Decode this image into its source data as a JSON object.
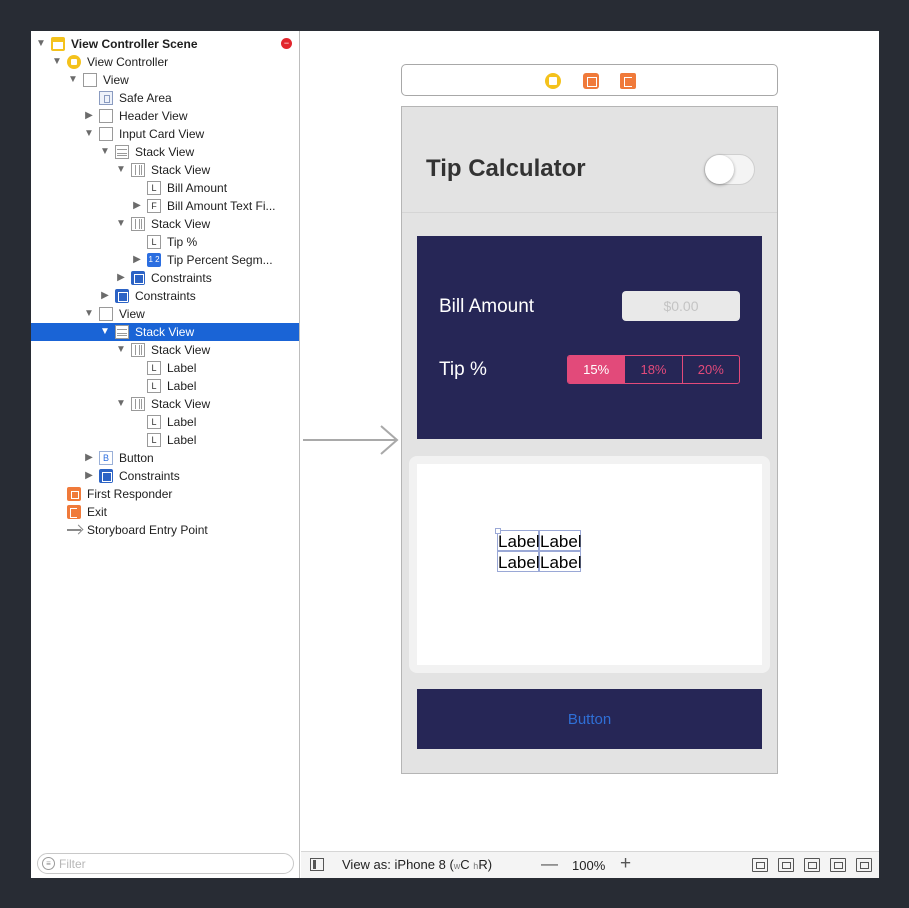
{
  "outline": {
    "rows": [
      {
        "label": "View Controller Scene",
        "depth": 0,
        "disclosure": "▼",
        "icon": "scene-icon",
        "bold": true
      },
      {
        "label": "View Controller",
        "depth": 1,
        "disclosure": "▼",
        "icon": "view-controller-icon"
      },
      {
        "label": "View",
        "depth": 2,
        "disclosure": "▼",
        "icon": "view-icon"
      },
      {
        "label": "Safe Area",
        "depth": 3,
        "disclosure": "",
        "icon": "safe-area-icon"
      },
      {
        "label": "Header View",
        "depth": 3,
        "disclosure": "▶",
        "icon": "view-icon"
      },
      {
        "label": "Input Card View",
        "depth": 3,
        "disclosure": "▼",
        "icon": "view-icon"
      },
      {
        "label": "Stack View",
        "depth": 4,
        "disclosure": "▼",
        "icon": "vertical-stack-icon"
      },
      {
        "label": "Stack View",
        "depth": 5,
        "disclosure": "▼",
        "icon": "horizontal-stack-icon"
      },
      {
        "label": "Bill Amount",
        "depth": 6,
        "disclosure": "",
        "icon": "label-icon",
        "glyph": "L"
      },
      {
        "label": "Bill Amount Text Fi...",
        "depth": 6,
        "disclosure": "▶",
        "icon": "textfield-icon",
        "glyph": "F"
      },
      {
        "label": "Stack View",
        "depth": 5,
        "disclosure": "▼",
        "icon": "horizontal-stack-icon"
      },
      {
        "label": "Tip %",
        "depth": 6,
        "disclosure": "",
        "icon": "label-icon",
        "glyph": "L"
      },
      {
        "label": "Tip Percent Segm...",
        "depth": 6,
        "disclosure": "▶",
        "icon": "segmented-control-icon",
        "glyph": "1 2"
      },
      {
        "label": "Constraints",
        "depth": 5,
        "disclosure": "▶",
        "icon": "constraints-icon"
      },
      {
        "label": "Constraints",
        "depth": 4,
        "disclosure": "▶",
        "icon": "constraints-icon"
      },
      {
        "label": "View",
        "depth": 3,
        "disclosure": "▼",
        "icon": "view-icon"
      },
      {
        "label": "Stack View",
        "depth": 4,
        "disclosure": "▼",
        "icon": "vertical-stack-icon",
        "selected": true
      },
      {
        "label": "Stack View",
        "depth": 5,
        "disclosure": "▼",
        "icon": "horizontal-stack-icon"
      },
      {
        "label": "Label",
        "depth": 6,
        "disclosure": "",
        "icon": "label-icon",
        "glyph": "L"
      },
      {
        "label": "Label",
        "depth": 6,
        "disclosure": "",
        "icon": "label-icon",
        "glyph": "L"
      },
      {
        "label": "Stack View",
        "depth": 5,
        "disclosure": "▼",
        "icon": "horizontal-stack-icon"
      },
      {
        "label": "Label",
        "depth": 6,
        "disclosure": "",
        "icon": "label-icon",
        "glyph": "L"
      },
      {
        "label": "Label",
        "depth": 6,
        "disclosure": "",
        "icon": "label-icon",
        "glyph": "L"
      },
      {
        "label": "Button",
        "depth": 3,
        "disclosure": "▶",
        "icon": "button-icon",
        "glyph": "B"
      },
      {
        "label": "Constraints",
        "depth": 3,
        "disclosure": "▶",
        "icon": "constraints-icon"
      },
      {
        "label": "First Responder",
        "depth": 1,
        "disclosure": "",
        "icon": "first-responder-icon"
      },
      {
        "label": "Exit",
        "depth": 1,
        "disclosure": "",
        "icon": "exit-icon"
      },
      {
        "label": "Storyboard Entry Point",
        "depth": 1,
        "disclosure": "",
        "icon": "entry-point-icon"
      }
    ],
    "filter_placeholder": "Filter"
  },
  "scene": {
    "title": "Tip Calculator",
    "bill_label": "Bill Amount",
    "bill_placeholder": "$0.00",
    "tip_label": "Tip %",
    "tip_segments": [
      "15%",
      "18%",
      "20%"
    ],
    "selected_segment": "15%",
    "result_labels": [
      "Label",
      "Label",
      "Label",
      "Label"
    ],
    "button_label": "Button"
  },
  "bottom_bar": {
    "view_as_prefix": "View as: iPhone 8 (",
    "size_w": "w",
    "size_w_class": "C",
    "size_h": "h",
    "size_h_class": "R",
    "view_as_suffix": ")",
    "zoom_minus": "—",
    "zoom_level": "100%",
    "zoom_plus": "+"
  },
  "colors": {
    "selection": "#1a64d6",
    "card_navy": "#262656",
    "accent_pink": "#e24a7a",
    "button_text": "#2f6fd6",
    "error_red": "#e2262d"
  }
}
